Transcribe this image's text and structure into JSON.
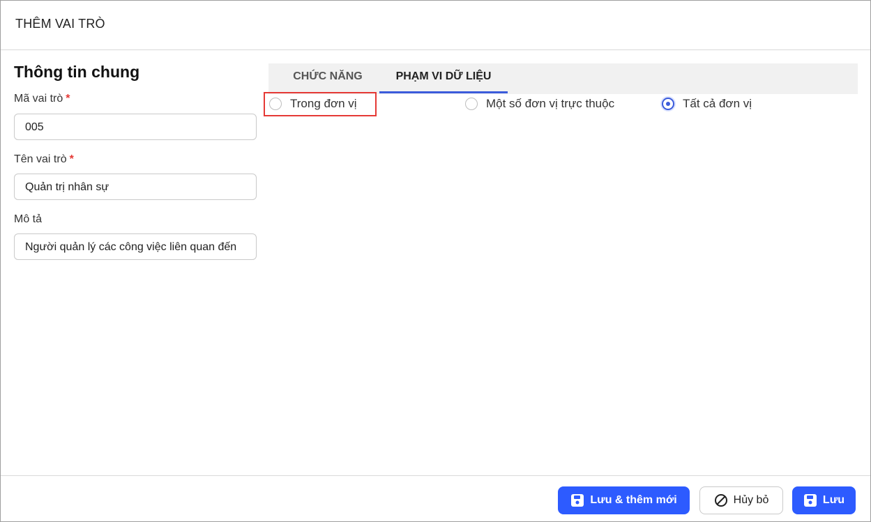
{
  "dialog": {
    "title": "THÊM VAI TRÒ"
  },
  "general": {
    "title": "Thông tin chung",
    "code": {
      "label": "Mã vai trò",
      "required": "*",
      "value": "005"
    },
    "name": {
      "label": "Tên vai trò",
      "required": "*",
      "value": "Quản trị nhân sự"
    },
    "description": {
      "label": "Mô tả",
      "value": "Người quản lý các công việc liên quan đến"
    }
  },
  "tabs": [
    {
      "label": "CHỨC NĂNG",
      "active": false
    },
    {
      "label": "PHẠM VI DỮ LIỆU",
      "active": true
    }
  ],
  "data_scope": {
    "options": [
      {
        "label": "Trong đơn vị",
        "checked": false
      },
      {
        "label": "Một số đơn vị trực thuộc",
        "checked": false
      },
      {
        "label": "Tất cả đơn vị",
        "checked": true
      }
    ]
  },
  "footer": {
    "save_and_new": "Lưu & thêm mới",
    "cancel": "Hủy bỏ",
    "save": "Lưu"
  },
  "colors": {
    "primary": "#2d5bff",
    "required": "#e53935",
    "tab_indicator": "#3b5bdb",
    "highlight": "#e53935"
  },
  "icons": {
    "save": "floppy-disk-icon",
    "cancel": "prohibit-icon"
  }
}
